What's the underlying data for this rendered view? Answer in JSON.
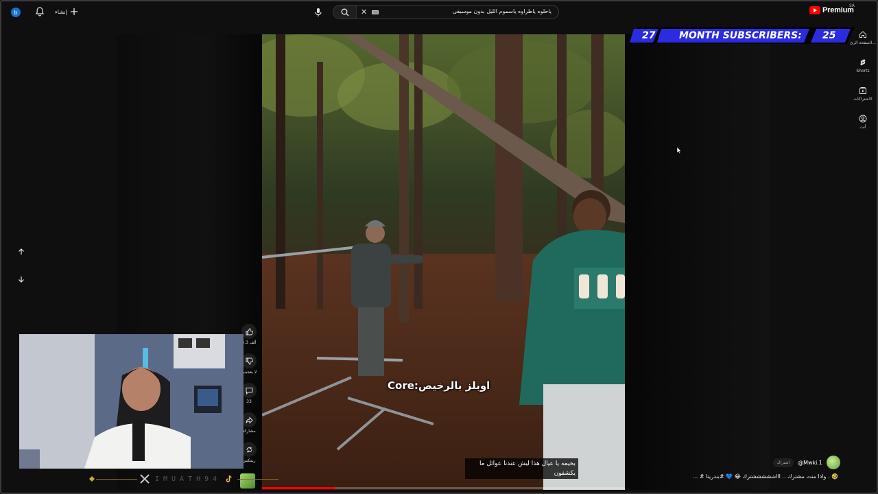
{
  "topbar": {
    "logo_text": "Premium",
    "country_code": "SA",
    "search_query": "ياحلوه ياطراوه ياسموم الليل بدون موسيقى",
    "create_label": "إنشاء",
    "icons": [
      "youtube-logo",
      "search-icon",
      "mic-icon",
      "clear-icon",
      "keyboard-icon",
      "plus-icon",
      "bell-icon",
      "avatar-icon"
    ]
  },
  "sidebar": {
    "items": [
      {
        "label": "الصفحة الرئ...",
        "icon": "home-icon"
      },
      {
        "label": "Shorts",
        "icon": "shorts-icon"
      },
      {
        "label": "الاشتراكات",
        "icon": "subscriptions-icon"
      },
      {
        "label": "أنت",
        "icon": "you-icon"
      }
    ]
  },
  "banner": {
    "left_number": "27",
    "text": "MONTH SUBSCRIBERS:",
    "right_number": "25",
    "color": "#2b2be0"
  },
  "video": {
    "caption": "اوبلز بالرخيص:Core",
    "subtitle_line1": "بخيمه يا عيال هذا ليش عندنا عوائل ما",
    "subtitle_line2": "يكشفون",
    "progress_fraction": 0.2
  },
  "actions": {
    "like_count": "4.3 ألف",
    "dislike_label": "لا يعجبني",
    "comments_count": "33",
    "share_label": "مشاركة",
    "remix_label": "ريمكس"
  },
  "stream_overlay": {
    "handle": "IMUATH94"
  },
  "channel": {
    "name": "@Mwki.1",
    "subscribe_label": "اشتراك",
    "description": "🤣 . واذا منت مشترك .. اااشششششترك 😂 💙 #بندريتا  # ..."
  },
  "colors": {
    "accent": "#ff0000",
    "background": "#0f0f0f"
  }
}
